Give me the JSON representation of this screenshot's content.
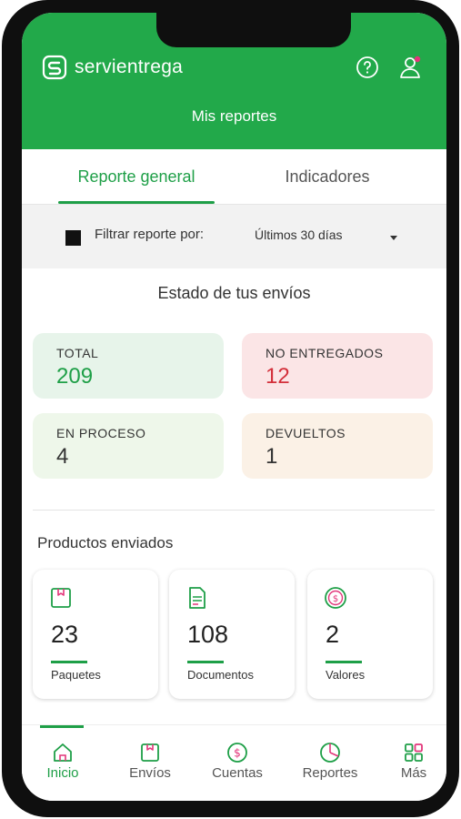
{
  "header": {
    "brand": "servientrega",
    "title": "Mis reportes"
  },
  "tabs": [
    {
      "label": "Reporte general"
    },
    {
      "label": "Indicadores"
    }
  ],
  "filter": {
    "label": "Filtrar reporte por:",
    "value": "Últimos 30 días"
  },
  "status": {
    "title": "Estado de tus envíos",
    "cards": [
      {
        "label": "TOTAL",
        "value": "209",
        "color": "#1e9f47",
        "bg": "#e7f4ea"
      },
      {
        "label": "NO ENTREGADOS",
        "value": "12",
        "color": "#d32f3a",
        "bg": "#fbe5e6"
      },
      {
        "label": "EN PROCESO",
        "value": "4",
        "color": "#333333",
        "bg": "#eef7ea"
      },
      {
        "label": "DEVUELTOS",
        "value": "1",
        "color": "#333333",
        "bg": "#fbf1e6"
      }
    ]
  },
  "products": {
    "title": "Productos enviados",
    "items": [
      {
        "icon": "package-icon",
        "value": "23",
        "label": "Paquetes"
      },
      {
        "icon": "document-icon",
        "value": "108",
        "label": "Documentos"
      },
      {
        "icon": "coin-icon",
        "value": "2",
        "label": "Valores"
      }
    ]
  },
  "bottom_nav": {
    "items": [
      {
        "label": "Inicio",
        "icon": "home-icon",
        "active": true
      },
      {
        "label": "Envíos",
        "icon": "package-icon"
      },
      {
        "label": "Cuentas",
        "icon": "dollar-coin-icon"
      },
      {
        "label": "Reportes",
        "icon": "pie-chart-icon"
      },
      {
        "label": "Más",
        "icon": "grid-icon"
      }
    ]
  },
  "colors": {
    "brand_green": "#22a94a",
    "accent_pink": "#e2357a"
  }
}
